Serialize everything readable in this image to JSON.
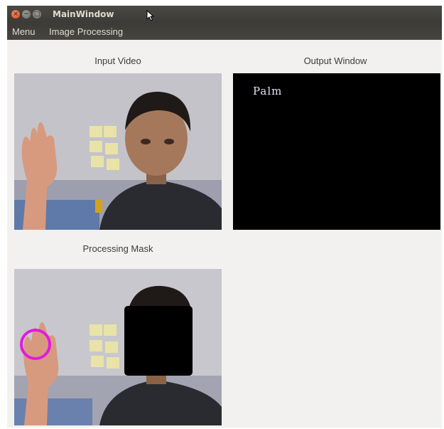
{
  "window": {
    "title": "MainWindow",
    "controls": {
      "close": "×",
      "minimize": "−",
      "maximize": "□"
    }
  },
  "menubar": {
    "items": [
      "Menu",
      "Image Processing"
    ]
  },
  "panels": {
    "input": {
      "label": "Input Video"
    },
    "output": {
      "label": "Output Window",
      "gesture_text": "Palm"
    },
    "mask": {
      "label": "Processing Mask"
    }
  },
  "colors": {
    "titlebar": "#3c3b37",
    "window_bg": "#f2f1f0",
    "tracker_circle": "#e21adf",
    "close_button": "#df4a16"
  }
}
